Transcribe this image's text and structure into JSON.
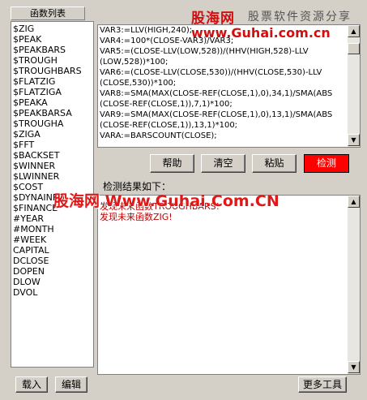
{
  "function_list": {
    "header": "函数列表",
    "items": [
      "$ZIG",
      "$PEAK",
      "$PEAKBARS",
      "$TROUGH",
      "$TROUGHBARS",
      "$FLATZIG",
      "$FLATZIGA",
      "$PEAKA",
      "$PEAKBARSA",
      "$TROUGHA",
      "$ZIGA",
      "$FFT",
      "$BACKSET",
      "$WINNER",
      "$LWINNER",
      "$COST",
      "$DYNAINFO",
      "$FINANCE",
      "#YEAR",
      "#MONTH",
      "#WEEK",
      "CAPITAL",
      "DCLOSE",
      "DOPEN",
      "DLOW",
      "DVOL"
    ]
  },
  "code_lines": [
    "VAR3:=LLV(HIGH,240);",
    "VAR4:=100*(CLOSE-VAR3)/VAR3;",
    "VAR5:=(CLOSE-LLV(LOW,528))/(HHV(HIGH,528)-LLV",
    "(LOW,528))*100;",
    "VAR6:=(CLOSE-LLV(CLOSE,530))/(HHV(CLOSE,530)-LLV",
    "(CLOSE,530))*100;",
    "VAR8:=SMA(MAX(CLOSE-REF(CLOSE,1),0),34,1)/SMA(ABS",
    "(CLOSE-REF(CLOSE,1)),7,1)*100;",
    "VAR9:=SMA(MAX(CLOSE-REF(CLOSE,1),0),13,1)/SMA(ABS",
    "(CLOSE-REF(CLOSE,1)),13,1)*100;",
    "VARA:=BARSCOUNT(CLOSE);"
  ],
  "buttons": {
    "help": "帮助",
    "clear": "清空",
    "paste": "粘贴",
    "check": "检测",
    "load": "载入",
    "edit": "编辑",
    "more_tools": "更多工具"
  },
  "result": {
    "label": "检测结果如下：",
    "lines": [
      "发现未来函数TROUGHBARS!",
      "发现未来函数ZIG!"
    ]
  },
  "watermark": {
    "logo": "股海网",
    "slogan": "股票软件资源分享",
    "url": "www.Guhai.com.cn",
    "center": "股海网 Www.Guhai.Com.CN"
  },
  "colors": {
    "check_button": "#ff0000",
    "result_text": "#c00000"
  }
}
